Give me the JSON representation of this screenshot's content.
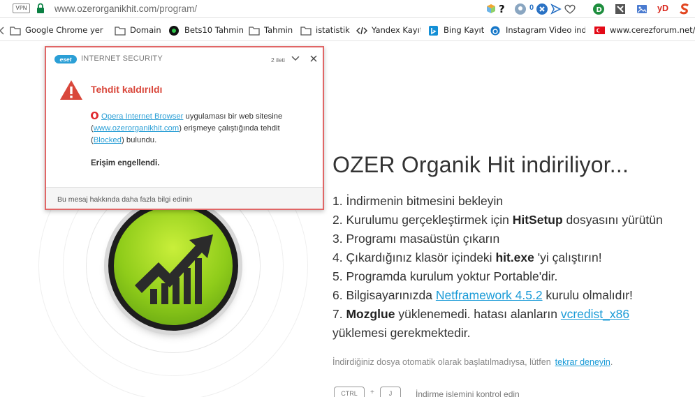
{
  "browser": {
    "vpn_label": "VPN",
    "url_host": "www.ozerorganikhit.com",
    "url_path": "/program/",
    "extension_badge": "0",
    "extension_yd": "yD"
  },
  "bookmarks": [
    {
      "label": "Google Chrome yer i",
      "icon": "folder-icon"
    },
    {
      "label": "Domain",
      "icon": "folder-icon"
    },
    {
      "label": "Bets10 Tahmin",
      "icon": "bets10-icon"
    },
    {
      "label": "Tahmin",
      "icon": "folder-icon"
    },
    {
      "label": "istatistik",
      "icon": "folder-icon"
    },
    {
      "label": "Yandex Kayıt",
      "icon": "code-icon"
    },
    {
      "label": "Bing Kayıt",
      "icon": "bing-icon"
    },
    {
      "label": "Instagram Video indi",
      "icon": "instagram-icon"
    },
    {
      "label": "www.cerezforum.net/",
      "icon": "turkey-flag-icon"
    }
  ],
  "eset": {
    "logo_text": "eset",
    "product": "INTERNET SECURITY",
    "message_count": "2 ileti",
    "title": "Tehdit kaldırıldı",
    "app_name": "Opera Internet Browser",
    "body_1": " uygulaması bir web sitesine",
    "site_open": "(",
    "site": "www.ozerorganikhit.com",
    "body_2": ") erişmeye çalıştığında tehdit",
    "blocked_open": "(",
    "blocked": "Blocked",
    "body_3": ") bulundu.",
    "access_blocked": "Erişim engellendi.",
    "more_info": "Bu mesaj hakkında daha fazla bilgi edinin"
  },
  "page": {
    "headline": "OZER Organik Hit indiriliyor...",
    "steps": {
      "s1": "1. İndirmenin bitmesini bekleyin",
      "s2_a": "2. Kurulumu gerçekleştirmek için ",
      "s2_b": "HitSetup",
      "s2_c": " dosyasını yürütün",
      "s3": "3. Programı masaüstün çıkarın",
      "s4_a": "4. Çıkardığınız klasör içindeki ",
      "s4_b": "hit.exe",
      "s4_c": " 'yi çalıştırın!",
      "s5": "5. Programda kurulum yoktur Portable'dir.",
      "s6_a": "6. Bilgisayarınızda ",
      "s6_link": "Netframework 4.5.2",
      "s6_c": " kurulu olmalıdır!",
      "s7_a": "7. ",
      "s7_b": "Mozglue",
      "s7_c": " yüklenemedi. hatası alanların ",
      "s7_link": "vcredist_x86",
      "s7_d": "yüklemesi gerekmektedir."
    },
    "retry_text": "İndirdiğiniz dosya otomatik olarak başlatılmadıysa, lütfen",
    "retry_link": "tekrar deneyin",
    "retry_end": ".",
    "key_ctrl": "CTRL",
    "key_plus": "+",
    "key_j": "J",
    "shortcut_text": "İndirme işlemini kontrol edin"
  }
}
